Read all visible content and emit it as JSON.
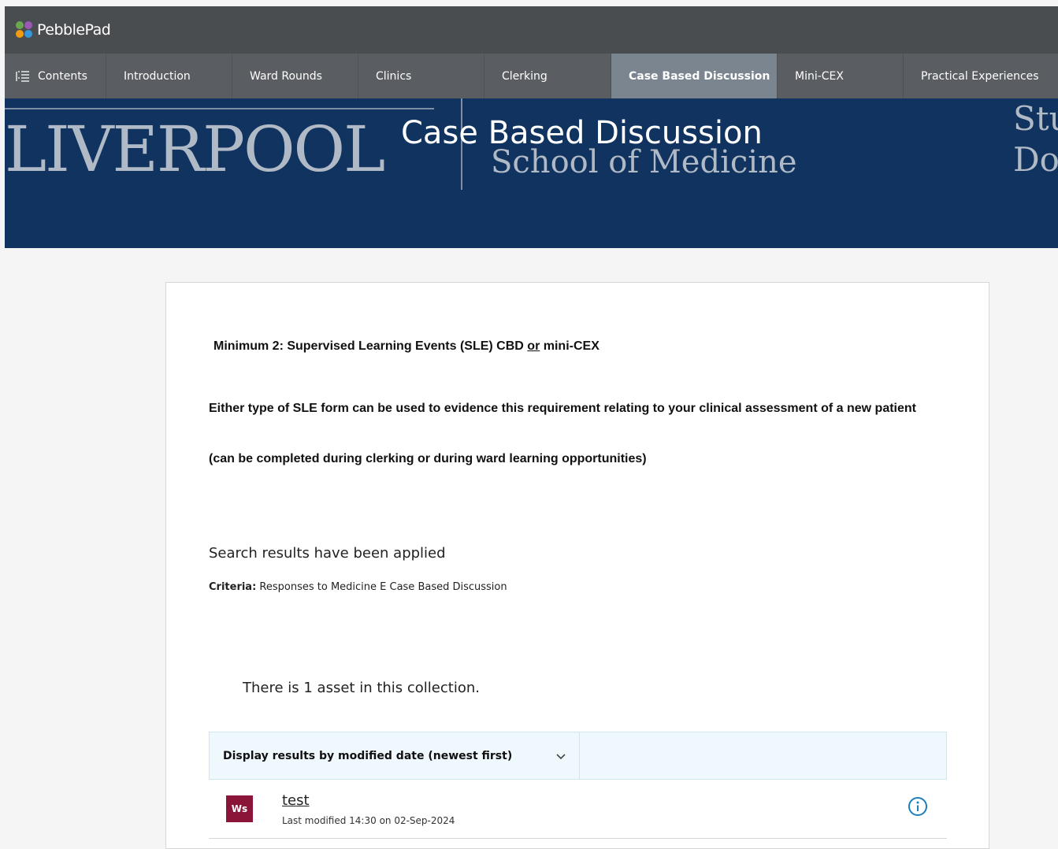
{
  "app": {
    "name": "PebblePad"
  },
  "nav": {
    "contents_label": "Contents",
    "tabs": [
      {
        "label": "Introduction"
      },
      {
        "label": "Ward Rounds"
      },
      {
        "label": "Clinics"
      },
      {
        "label": "Clerking"
      },
      {
        "label": "Case Based Discussion"
      },
      {
        "label": "Mini-CEX"
      },
      {
        "label": "Practical Experiences"
      }
    ],
    "active_tab": "Case Based Discussion"
  },
  "banner": {
    "title": "Case Based Discussion",
    "logo_word": "LIVERPOOL",
    "logo_subtitle": "School of Medicine",
    "partial_text_line1": "Stu",
    "partial_text_line2": "Do"
  },
  "content": {
    "requirement_heading_pre": "Minimum 2: Supervised Learning Events (SLE) CBD ",
    "requirement_heading_or": "or",
    "requirement_heading_post": " mini-CEX",
    "requirement_body": "Either type of SLE form can be used to evidence this requirement relating to your clinical assessment of a new patient",
    "requirement_note": "(can be completed during clerking or during ward learning opportunities)",
    "search_status": "Search results have been applied",
    "criteria_label": "Criteria:",
    "criteria_value": " Responses to Medicine E Case Based Discussion",
    "asset_count_text": "There is 1 asset in this collection."
  },
  "sort": {
    "selected_label": "Display results by modified date (newest first)"
  },
  "results": [
    {
      "type_badge": "Ws",
      "title": "test",
      "meta": "Last modified 14:30 on 02-Sep-2024"
    }
  ],
  "colors": {
    "topbar": "#4a4d50",
    "navbar": "#5a5d61",
    "nav_active": "#7a858f",
    "banner": "#10335f",
    "badge": "#8a1538",
    "info_icon": "#1a7fc1"
  }
}
